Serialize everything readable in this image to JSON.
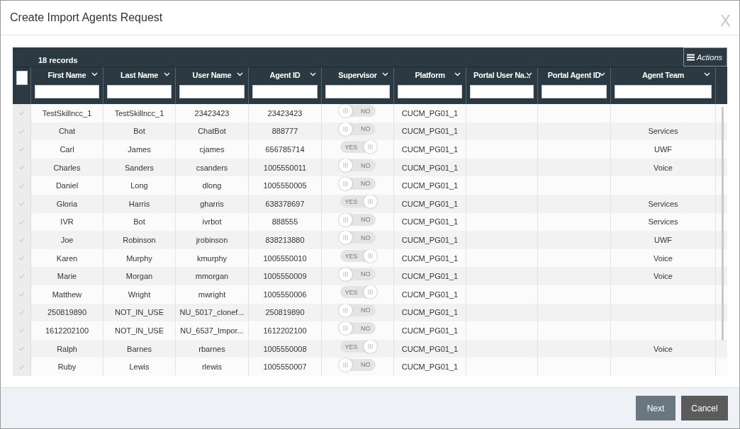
{
  "dialog": {
    "title": "Create Import Agents Request",
    "close": "X"
  },
  "table": {
    "record_count": "18 records",
    "actions": "Actions",
    "select_all": {
      "checked": false
    },
    "columns": [
      "First Name",
      "Last Name",
      "User Name",
      "Agent ID",
      "Supervisor",
      "Platform",
      "Portal User Na...",
      "Portal Agent ID",
      "Agent Team"
    ],
    "rows": [
      {
        "selected": false,
        "first": "TestSkillncc_1",
        "last": "TestSkillncc_1",
        "user": "23423423",
        "agent_id": "23423423",
        "supervisor": false,
        "supervisor_label": "NO",
        "platform": "CUCM_PG01_1"
      },
      {
        "selected": false,
        "first": "Chat",
        "last": "Bot",
        "user": "ChatBot",
        "agent_id": "888777",
        "supervisor": false,
        "supervisor_label": "NO",
        "platform": "CUCM_PG01_1",
        "team": "Services"
      },
      {
        "selected": false,
        "first": "Carl",
        "last": "James",
        "user": "cjames",
        "agent_id": "656785714",
        "supervisor": true,
        "supervisor_label": "YES",
        "platform": "CUCM_PG01_1",
        "team": "UWF"
      },
      {
        "selected": false,
        "first": "Charles",
        "last": "Sanders",
        "user": "csanders",
        "agent_id": "1005550011",
        "supervisor": false,
        "supervisor_label": "NO",
        "platform": "CUCM_PG01_1",
        "team": "Voice"
      },
      {
        "selected": false,
        "first": "Daniel",
        "last": "Long",
        "user": "dlong",
        "agent_id": "1005550005",
        "supervisor": false,
        "supervisor_label": "NO",
        "platform": "CUCM_PG01_1"
      },
      {
        "selected": false,
        "first": "Gloria",
        "last": "Harris",
        "user": "gharris",
        "agent_id": "638378697",
        "supervisor": true,
        "supervisor_label": "YES",
        "platform": "CUCM_PG01_1",
        "team": "Services"
      },
      {
        "selected": false,
        "first": "IVR",
        "last": "Bot",
        "user": "ivrbot",
        "agent_id": "888555",
        "supervisor": false,
        "supervisor_label": "NO",
        "platform": "CUCM_PG01_1",
        "team": "Services"
      },
      {
        "selected": false,
        "first": "Joe",
        "last": "Robinson",
        "user": "jrobinson",
        "agent_id": "838213880",
        "supervisor": false,
        "supervisor_label": "NO",
        "platform": "CUCM_PG01_1",
        "team": "UWF"
      },
      {
        "selected": false,
        "first": "Karen",
        "last": "Murphy",
        "user": "kmurphy",
        "agent_id": "1005550010",
        "supervisor": true,
        "supervisor_label": "YES",
        "platform": "CUCM_PG01_1",
        "team": "Voice"
      },
      {
        "selected": false,
        "first": "Marie",
        "last": "Morgan",
        "user": "mmorgan",
        "agent_id": "1005550009",
        "supervisor": false,
        "supervisor_label": "NO",
        "platform": "CUCM_PG01_1",
        "team": "Voice"
      },
      {
        "selected": false,
        "first": "Matthew",
        "last": "Wright",
        "user": "mwright",
        "agent_id": "1005550006",
        "supervisor": true,
        "supervisor_label": "YES",
        "platform": "CUCM_PG01_1"
      },
      {
        "selected": false,
        "first": "250819890",
        "last": "NOT_IN_USE",
        "user": "NU_5017_clonef...",
        "agent_id": "250819890",
        "supervisor": false,
        "supervisor_label": "NO",
        "platform": "CUCM_PG01_1"
      },
      {
        "selected": false,
        "first": "1612202100",
        "last": "NOT_IN_USE",
        "user": "NU_6537_Impor...",
        "agent_id": "1612202100",
        "supervisor": false,
        "supervisor_label": "NO",
        "platform": "CUCM_PG01_1"
      },
      {
        "selected": false,
        "first": "Ralph",
        "last": "Barnes",
        "user": "rbarnes",
        "agent_id": "1005550008",
        "supervisor": true,
        "supervisor_label": "YES",
        "platform": "CUCM_PG01_1",
        "team": "Voice"
      },
      {
        "selected": false,
        "first": "Ruby",
        "last": "Lewis",
        "user": "rlewis",
        "agent_id": "1005550007",
        "supervisor": false,
        "supervisor_label": "NO",
        "platform": "CUCM_PG01_1"
      }
    ]
  },
  "buttons": [
    "Next",
    "Cancel"
  ]
}
